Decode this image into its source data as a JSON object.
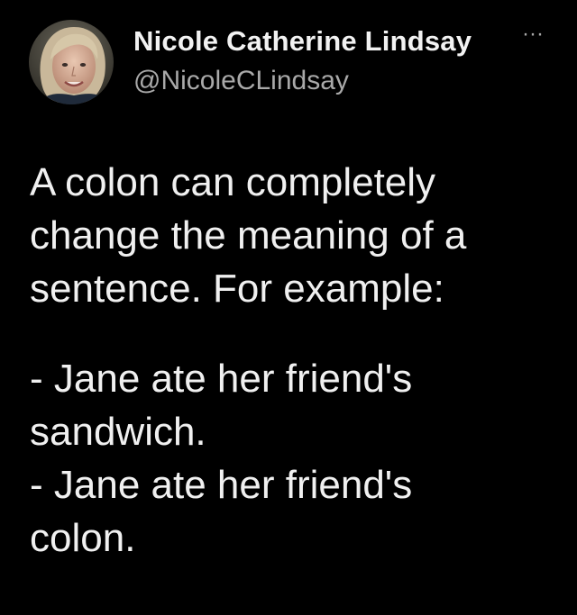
{
  "author": {
    "display_name": "Nicole Catherine Lindsay",
    "handle": "@NicoleCLindsay",
    "avatar_icon": "profile-photo-icon"
  },
  "menu": {
    "more_label": "···",
    "more_icon": "more-options-icon"
  },
  "tweet": {
    "paragraph_1": "A colon can completely\nchange the meaning of a\nsentence. For example:",
    "paragraph_2": "- Jane ate her friend's\nsandwich.\n- Jane ate her friend's\ncolon."
  },
  "colors": {
    "background": "#000000",
    "text": "#f0f0f0",
    "secondary_text": "#a9a9a9"
  }
}
